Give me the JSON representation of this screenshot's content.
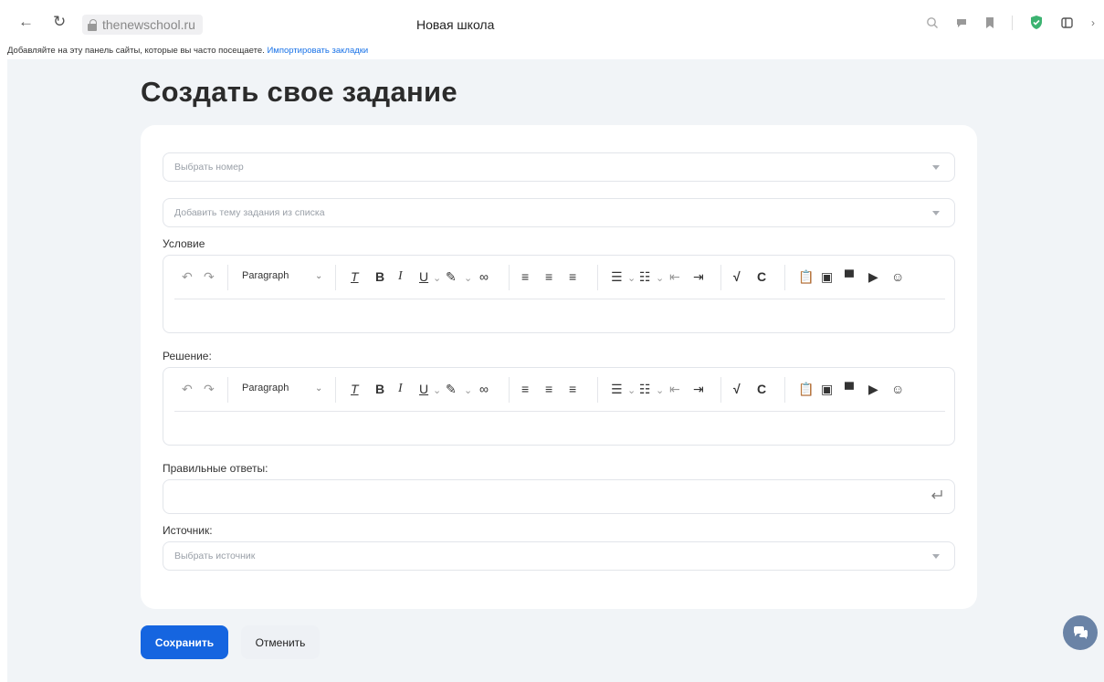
{
  "browser": {
    "back_icon": "←",
    "reload_icon": "↻",
    "url": "thenewschool.ru",
    "tab_title": "Новая школа",
    "bookmark_prompt": "Добавляйте на эту панель сайты, которые вы часто посещаете.",
    "import_link": "Импортировать закладки"
  },
  "page": {
    "title": "Создать свое задание",
    "select_number_placeholder": "Выбрать номер",
    "select_topic_placeholder": "Добавить тему задания из списка",
    "condition_label": "Условие",
    "solution_label": "Решение:",
    "answers_label": "Правильные ответы:",
    "source_label": "Источник:",
    "select_source_placeholder": "Выбрать источник"
  },
  "editor": {
    "paragraph_label": "Paragraph"
  },
  "actions": {
    "save": "Сохранить",
    "cancel": "Отменить"
  },
  "colors": {
    "primary": "#1565e0",
    "page_bg": "#f1f4f7",
    "shield_green": "#3cb371",
    "chat_fab": "#6a83a6"
  }
}
